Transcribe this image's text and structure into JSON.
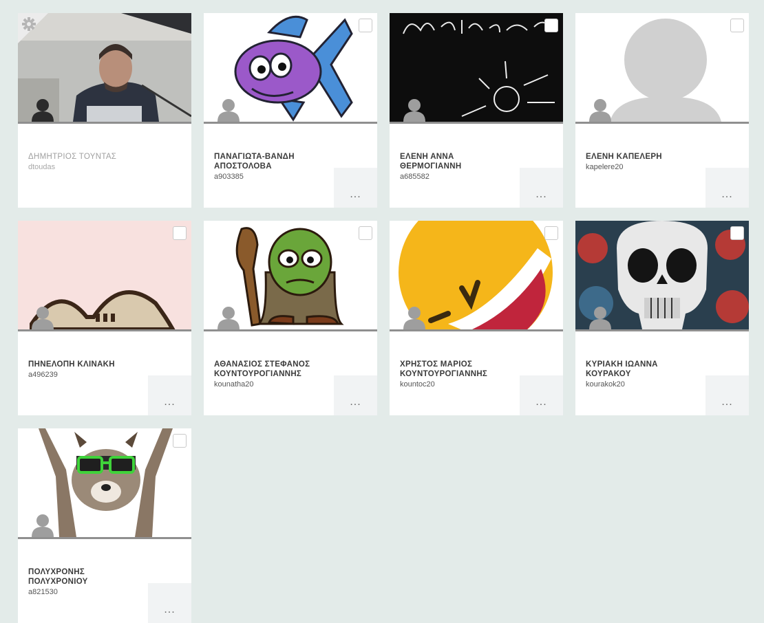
{
  "colors": {
    "background": "#e3ebe9",
    "card": "#ffffff",
    "divider": "#8f8f8f",
    "role_icon": "#9e9e9e"
  },
  "participants": [
    {
      "name": "ΔΗΜΗΤΡΙΟΣ ΤΟΥΝΤΑΣ",
      "username": "dtoudas",
      "avatar": "teacher-webcam-photo",
      "role": "owner",
      "icon": "gear-icon",
      "inactive": true
    },
    {
      "name": "ΠΑΝΑΓΙΩΤΑ-ΒΑΝΔΗ ΑΠΟΣΤΟΛΟΒΑ",
      "username": "a903385",
      "avatar": "purple-fish-cartoon",
      "more_label": "..."
    },
    {
      "name": "ΕΛΕΝΗ ΑΝΝΑ ΘΕΡΜΟΓΙΑΝΝΗ",
      "username": "a685582",
      "avatar": "welcome-chalkboard",
      "more_label": "..."
    },
    {
      "name": "ΕΛΕΝΗ ΚΑΠΕΛΕΡΗ",
      "username": "kapelere20",
      "avatar": "default-silhouette",
      "more_label": "..."
    },
    {
      "name": "ΠΗΝΕΛΟΠΗ ΚΛΙΝΑΚΗ",
      "username": "a496239",
      "avatar": "hi-cartoon",
      "more_label": "..."
    },
    {
      "name": "ΑΘΑΝΑΣΙΟΣ ΣΤΕΦΑΝΟΣ ΚΟΥΝΤΟΥΡΟΓΙΑΝΝΗΣ",
      "username": "kounatha20",
      "avatar": "green-goblin-cartoon",
      "more_label": "..."
    },
    {
      "name": "ΧΡΗΣΤΟΣ ΜΑΡΙΟΣ ΚΟΥΝΤΟΥΡΟΓΙΑΝΝΗΣ",
      "username": "kountoc20",
      "avatar": "laughing-emoji",
      "more_label": "..."
    },
    {
      "name": "ΚΥΡΙΑΚΗ ΙΩΑΝΝΑ ΚΟΥΡΑΚΟΥ",
      "username": "kourakok20",
      "avatar": "skull-roses",
      "more_label": "..."
    },
    {
      "name": "ΠΟΛΥΧΡΟΝΗΣ ΠΟΛΥΧΡΟΝΙΟΥ",
      "username": "a821530",
      "avatar": "raccoon-sunglasses",
      "more_label": "..."
    }
  ]
}
